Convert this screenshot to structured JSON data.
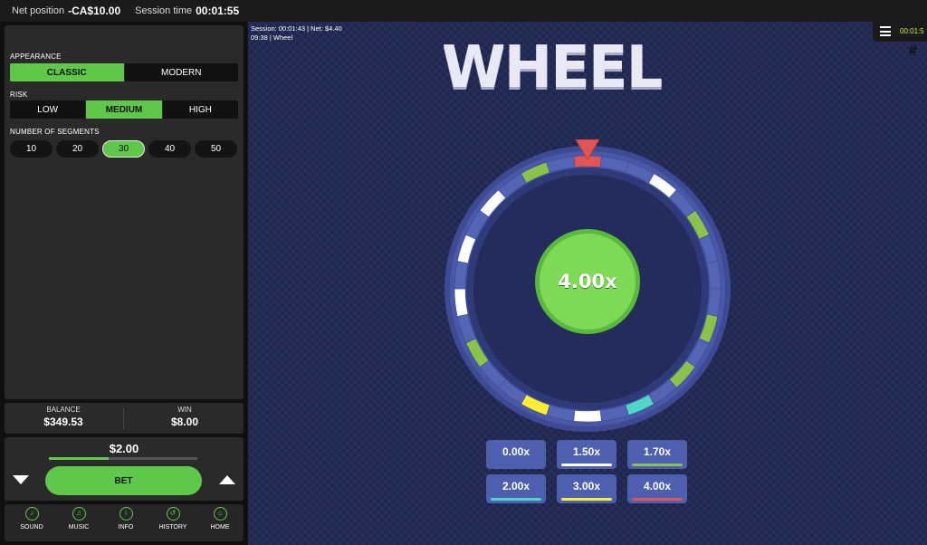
{
  "topbar": {
    "net_label": "Net position",
    "net_value": "-CA$10.00",
    "session_label": "Session time",
    "session_value": "00:01:55"
  },
  "settings": {
    "appearance_label": "APPEARANCE",
    "appearance_options": [
      "CLASSIC",
      "MODERN"
    ],
    "appearance_selected": "CLASSIC",
    "risk_label": "RISK",
    "risk_options": [
      "LOW",
      "MEDIUM",
      "HIGH"
    ],
    "risk_selected": "MEDIUM",
    "segments_label": "NUMBER OF SEGMENTS",
    "segments_options": [
      "10",
      "20",
      "30",
      "40",
      "50"
    ],
    "segments_selected": "30"
  },
  "balance": {
    "balance_label": "BALANCE",
    "balance_value": "$349.53",
    "win_label": "WIN",
    "win_value": "$8.00"
  },
  "bet": {
    "amount": "$2.00",
    "amount_fraction": 0.4,
    "button_label": "BET"
  },
  "nav": [
    {
      "label": "SOUND",
      "icon": "sound-icon",
      "glyph": "♪"
    },
    {
      "label": "MUSIC",
      "icon": "music-icon",
      "glyph": "♫"
    },
    {
      "label": "INFO",
      "icon": "info-icon",
      "glyph": "i"
    },
    {
      "label": "HISTORY",
      "icon": "history-icon",
      "glyph": "↺"
    },
    {
      "label": "HOME",
      "icon": "home-icon",
      "glyph": "⌂"
    }
  ],
  "game": {
    "info_line1": "Session: 00:01:43  |  Net:  $4.40",
    "info_line2": "09:38  |  Wheel",
    "logo": "WHEEL",
    "clock": "00:01:5",
    "result": "4.00x",
    "colors": {
      "base": "#5565b5",
      "white": "#ffffff",
      "green": "#8bc34a",
      "teal": "#4fd6c8",
      "yellow": "#ffee33",
      "red": "#e05555",
      "center": "#7ed957"
    },
    "wheel_segments": [
      "red",
      "base",
      "base",
      "white",
      "base",
      "green",
      "base",
      "base",
      "base",
      "green",
      "base",
      "green",
      "base",
      "teal",
      "base",
      "white",
      "base",
      "yellow",
      "base",
      "base",
      "green",
      "base",
      "white",
      "base",
      "white",
      "base",
      "white",
      "base",
      "green",
      "base"
    ],
    "multipliers": [
      {
        "label": "0.00x",
        "color": ""
      },
      {
        "label": "1.50x",
        "color": "#ffffff"
      },
      {
        "label": "1.70x",
        "color": "#8bc34a"
      },
      {
        "label": "2.00x",
        "color": "#4fd6c8"
      },
      {
        "label": "3.00x",
        "color": "#ffee33"
      },
      {
        "label": "4.00x",
        "color": "#e05555"
      }
    ]
  }
}
